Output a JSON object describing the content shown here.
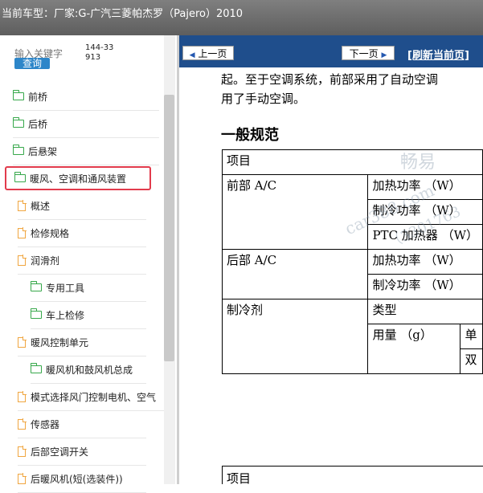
{
  "window": {
    "title": "当前车型：厂家:G-广汽三菱帕杰罗（Pajero）2010"
  },
  "search": {
    "label": "输入关键字",
    "code": "144-33913",
    "button": "查询"
  },
  "tree": [
    {
      "label": "前桥",
      "icon": "folder-icon"
    },
    {
      "label": "后桥",
      "icon": "folder-icon"
    },
    {
      "label": "后悬架",
      "icon": "folder-icon"
    },
    {
      "label": "暖风、空调和通风装置",
      "icon": "folder-icon-open"
    },
    {
      "label": "概述",
      "icon": "document-icon"
    },
    {
      "label": "检修规格",
      "icon": "document-icon"
    },
    {
      "label": "润滑剂",
      "icon": "document-icon"
    },
    {
      "label": "专用工具",
      "icon": "folder-icon"
    },
    {
      "label": "车上检修",
      "icon": "folder-icon"
    },
    {
      "label": "暖风控制单元",
      "icon": "document-icon"
    },
    {
      "label": "暖风机和鼓风机总成",
      "icon": "folder-icon"
    },
    {
      "label": "模式选择风门控制电机、空气",
      "icon": "document-icon"
    },
    {
      "label": "传感器",
      "icon": "document-icon"
    },
    {
      "label": "后部空调开关",
      "icon": "document-icon"
    },
    {
      "label": "后暖风机(短(选装件))",
      "icon": "document-icon"
    }
  ],
  "nav": {
    "prev": "上一页",
    "next": "下一页",
    "refresh": "[刷新当前页]"
  },
  "doc": {
    "para_line1": "起。至于空调系统，前部采用了自动空调",
    "para_line2": "用了手动空调。",
    "heading": "一般规范",
    "table": {
      "header": "项目",
      "front": "前部 A/C",
      "front_heat": "加热功率 （W）",
      "front_cool": "制冷功率 （W）",
      "front_ptc": "PTC 加热器 （W）",
      "rear": "后部 A/C",
      "rear_heat": "加热功率 （W）",
      "rear_cool": "制冷功率 （W）",
      "refrigerant": "制冷剂",
      "type": "类型",
      "amount": "用量 （g）",
      "single": "单",
      "double": "双"
    },
    "table2_header": "项目"
  },
  "watermark": {
    "line1": "畅易",
    "line2": "car388.com",
    "line3": "（3301763"
  }
}
